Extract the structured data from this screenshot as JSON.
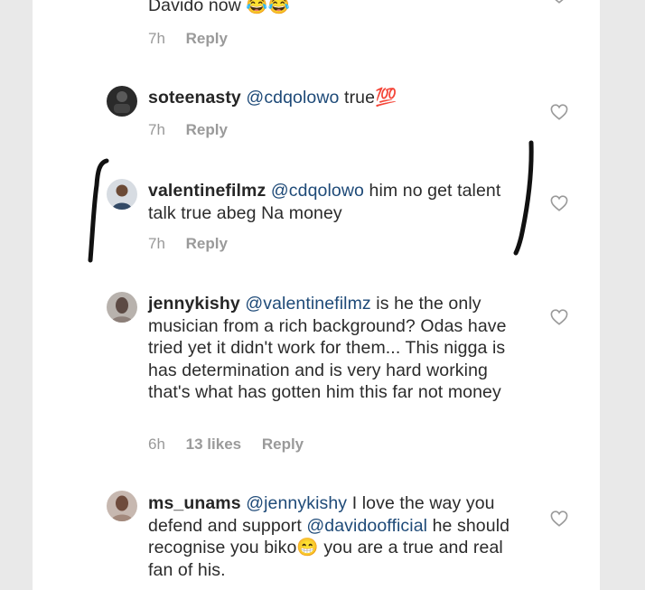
{
  "top_comment": {
    "text_fragment": "Davido now",
    "emoji": "😂😂",
    "time": "7h",
    "reply_label": "Reply"
  },
  "comments": [
    {
      "username": "soteenasty",
      "mention": "@cdqolowo",
      "text": "true",
      "emoji": "💯",
      "time": "7h",
      "likes": "",
      "reply_label": "Reply"
    },
    {
      "username": "valentinefilmz",
      "mention": "@cdqolowo",
      "text": "him no get talent talk true abeg Na money",
      "time": "7h",
      "likes": "",
      "reply_label": "Reply"
    },
    {
      "username": "jennykishy",
      "mention": "@valentinefilmz",
      "text": "is he the only musician from a rich background?  Odas have tried yet it didn't work for them... This nigga is has determination and is very hard working that's what has gotten him this far not money",
      "time": "6h",
      "likes": "13 likes",
      "reply_label": "Reply"
    },
    {
      "username": "ms_unams",
      "mention": "@jennykishy",
      "text_before": "I love the way you defend and support",
      "mention2": "@davidoofficial",
      "text_after": "he should recognise you biko",
      "emoji": "😁",
      "text_end": "you are a true and real fan of his.",
      "time": "",
      "likes": "",
      "reply_label": ""
    }
  ],
  "colors": {
    "background": "#ffffff",
    "outer": "#e9e9e9",
    "username": "#262626",
    "mention": "#1e4a78",
    "meta": "#999999"
  },
  "icons": {
    "like": "heart-outline-icon",
    "annotation": "hand-drawn-bracket-marks"
  }
}
